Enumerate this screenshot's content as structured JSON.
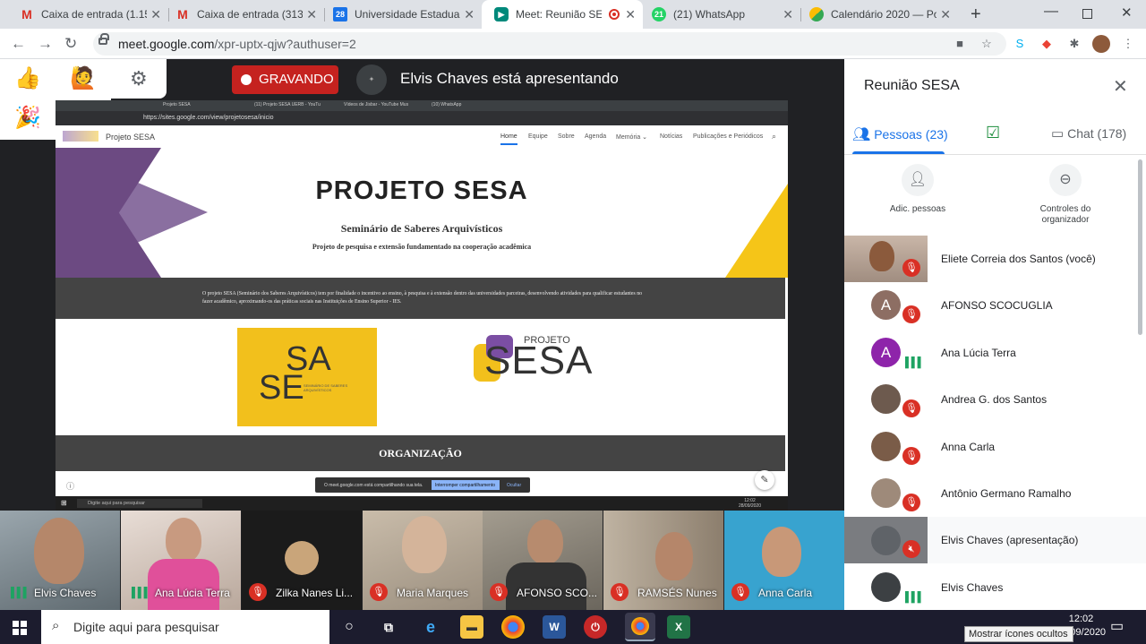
{
  "browser": {
    "tabs": [
      {
        "title": "Caixa de entrada (1.155)",
        "icon": "gmail-icon",
        "icon_text": "M",
        "color": "#d93025"
      },
      {
        "title": "Caixa de entrada (313) -",
        "icon": "gmail-icon",
        "icon_text": "M",
        "color": "#d93025"
      },
      {
        "title": "Universidade Estadual d",
        "icon": "calendar-icon",
        "icon_text": "28",
        "color": "#1a73e8"
      },
      {
        "title": "Meet: Reunião SESA",
        "icon": "meet-icon",
        "icon_text": "",
        "color": "#00897b"
      },
      {
        "title": "(21) WhatsApp",
        "icon": "whatsapp-icon",
        "icon_text": "21",
        "color": "#25d366"
      },
      {
        "title": "Calendário 2020 — Port",
        "icon": "drive-icon",
        "icon_text": "",
        "color": "#fbbc04"
      }
    ],
    "new_tab": "+",
    "url_host": "meet.google.com",
    "url_path": "/xpr-uptx-qjw?authuser=2",
    "ext_badge": "1"
  },
  "meet": {
    "recording_label": "GRAVANDO",
    "presenter_text": "Elvis Chaves está apresentando",
    "reactions": [
      "👍",
      "🙋",
      "⚙",
      "🎉",
      "🎇"
    ]
  },
  "shared_screen": {
    "mini_tabs": [
      "Projeto SESA",
      "(11) Projeto SESA UERB - YouTu",
      "Vídeos de Jisbar - YouTube Mus",
      "(10) WhatsApp"
    ],
    "url": "https://sites.google.com/view/projetosesa/inicio",
    "brand": "Projeto SESA",
    "nav": [
      "Home",
      "Equipe",
      "Sobre",
      "Agenda",
      "Memória ⌄",
      "Notícias",
      "Publicações e Periódicos"
    ],
    "title": "PROJETO SESA",
    "subtitle": "Seminário de Saberes Arquivísticos",
    "tagline": "Projeto de pesquisa e extensão fundamentado na cooperação acadêmica",
    "description": "O projeto SESA (Seminário dos Saberes Arquivísticos) tem por finalidade o incentivo ao ensino, à pesquisa e à extensão dentro das universidades parceiras, desenvolvendo atividades para qualificar estudantes no fazer acadêmico, aproximando-os das práticas sociais nas Instituições de Ensino Superior - IES.",
    "logo1_top": "SA",
    "logo1_bottom": "SE",
    "logo1_small": "SEMINÁRIO DE SABERES ARQUIVÍSTICOS",
    "logo2_small": "PROJETO",
    "logo2_big": "SESA",
    "section_heading": "ORGANIZAÇÃO",
    "share_message": "O meet.google.com está compartilhando sua tela.",
    "share_stop": "Interromper compartilhamento",
    "share_hide": "Ocultar",
    "win_search": "Digite aqui para pesquisar",
    "win_time": "12:02",
    "win_date": "28/09/2020"
  },
  "panel": {
    "title": "Reunião SESA",
    "tab_people": "Pessoas (23)",
    "tab_chat": "Chat (178)",
    "add_people": "Adic. pessoas",
    "host_controls": "Controles do organizador",
    "participants": [
      {
        "name": "Eliete Correia dos Santos (você)",
        "type": "video",
        "muted": true
      },
      {
        "name": "AFONSO SCOCUGLIA",
        "type": "avatar",
        "initial": "A",
        "color": "#8d6e63",
        "muted": true
      },
      {
        "name": "Ana Lúcia Terra",
        "type": "avatar",
        "initial": "A",
        "color": "#8e24aa",
        "muted": false
      },
      {
        "name": "Andrea G. dos Santos",
        "type": "photo",
        "color": "#6d5a4e",
        "muted": true
      },
      {
        "name": "Anna Carla",
        "type": "photo",
        "color": "#7a5c48",
        "muted": true
      },
      {
        "name": "Antônio Germano Ramalho",
        "type": "photo",
        "color": "#9e8a7a",
        "muted": true
      },
      {
        "name": "Elvis Chaves (apresentação)",
        "type": "presentation",
        "color": "#5f6368",
        "muted": true
      },
      {
        "name": "Elvis Chaves",
        "type": "photo",
        "color": "#3c4043",
        "muted": false
      }
    ]
  },
  "strip": [
    {
      "name": "Elvis Chaves",
      "state": "talking",
      "bg": "#7d8a93"
    },
    {
      "name": "Ana Lúcia Terra",
      "state": "talking",
      "bg": "#c9b9b0"
    },
    {
      "name": "Zilka Nanes Li...",
      "state": "muted",
      "bg": "#1b1b1b"
    },
    {
      "name": "Maria Marques",
      "state": "muted",
      "bg": "#b3a99a"
    },
    {
      "name": "AFONSO SCO...",
      "state": "muted",
      "bg": "#8a8478"
    },
    {
      "name": "RAMSÉS Nunes",
      "state": "muted",
      "bg": "#9c8e7e"
    },
    {
      "name": "Anna Carla",
      "state": "muted",
      "bg": "#38a3cf"
    }
  ],
  "taskbar": {
    "search_placeholder": "Digite aqui para pesquisar",
    "time": "12:02",
    "date": "28/09/2020",
    "tooltip": "Mostrar ícones ocultos"
  }
}
